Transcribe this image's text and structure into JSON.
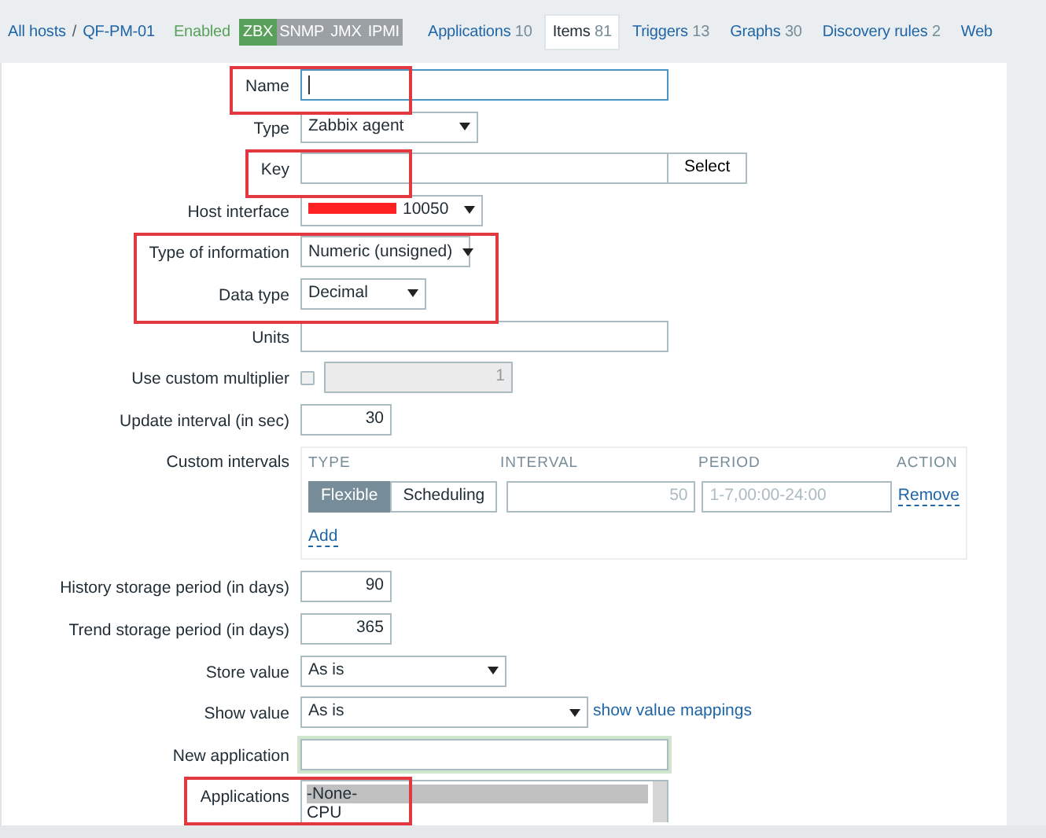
{
  "breadcrumbs": [
    {
      "label": "All hosts"
    },
    {
      "label": "QF-PM-01"
    }
  ],
  "breadcrumb_separator": "/",
  "host_status": "Enabled",
  "availability": [
    {
      "label": "ZBX",
      "on": true
    },
    {
      "label": "SNMP",
      "on": false
    },
    {
      "label": "JMX",
      "on": false
    },
    {
      "label": "IPMI",
      "on": false
    }
  ],
  "tabs": [
    {
      "label": "Applications",
      "count": "10",
      "selected": false
    },
    {
      "label": "Items",
      "count": "81",
      "selected": true
    },
    {
      "label": "Triggers",
      "count": "13",
      "selected": false
    },
    {
      "label": "Graphs",
      "count": "30",
      "selected": false
    },
    {
      "label": "Discovery rules",
      "count": "2",
      "selected": false
    },
    {
      "label": "Web",
      "selected": false
    }
  ],
  "form": [
    {
      "kind": "text",
      "label": "Name",
      "focused": true,
      "annotated": true
    },
    {
      "kind": "select",
      "label": "Type",
      "value": "Zabbix agent",
      "annotated": false
    },
    {
      "kind": "text_button",
      "label": "Key",
      "button": "Select",
      "annotated": true
    },
    {
      "kind": "select",
      "label": "Host interface",
      "value": "10050",
      "redacted": true,
      "annotated": false
    },
    {
      "kind": "select",
      "label": "Type of information",
      "value": "Numeric (unsigned)",
      "annotated": true
    },
    {
      "kind": "select",
      "label": "Data type",
      "value": "Decimal",
      "annotated": true
    },
    {
      "kind": "text",
      "label": "Units",
      "focused": false,
      "annotated": false
    },
    {
      "kind": "multiplier",
      "label": "Use custom multiplier",
      "checked": false,
      "value": "1",
      "disabled": true,
      "annotated": false
    },
    {
      "kind": "number",
      "label": "Update interval (in sec)",
      "value": "30",
      "annotated": false
    },
    {
      "kind": "intervals",
      "label": "Custom intervals",
      "columns": [
        "TYPE",
        "INTERVAL",
        "PERIOD",
        "ACTION"
      ],
      "modes": [
        {
          "label": "Flexible",
          "selected": true
        },
        {
          "label": "Scheduling",
          "selected": false
        }
      ],
      "interval": "50",
      "period": "1-7,00:00-24:00",
      "remove": "Remove",
      "add": "Add",
      "annotated": false
    },
    {
      "kind": "number",
      "label": "History storage period (in days)",
      "value": "90",
      "annotated": false
    },
    {
      "kind": "number",
      "label": "Trend storage period (in days)",
      "value": "365",
      "annotated": false
    },
    {
      "kind": "select",
      "label": "Store value",
      "value": "As is",
      "annotated": false
    },
    {
      "kind": "select_link",
      "label": "Show value",
      "value": "As is",
      "link": "show value mappings",
      "annotated": false
    },
    {
      "kind": "text",
      "label": "New application",
      "glow": true,
      "annotated": false
    },
    {
      "kind": "listbox",
      "label": "Applications",
      "options": [
        {
          "label": "-None-",
          "selected": true
        },
        {
          "label": "CPU",
          "selected": false
        }
      ],
      "annotated": true
    }
  ]
}
